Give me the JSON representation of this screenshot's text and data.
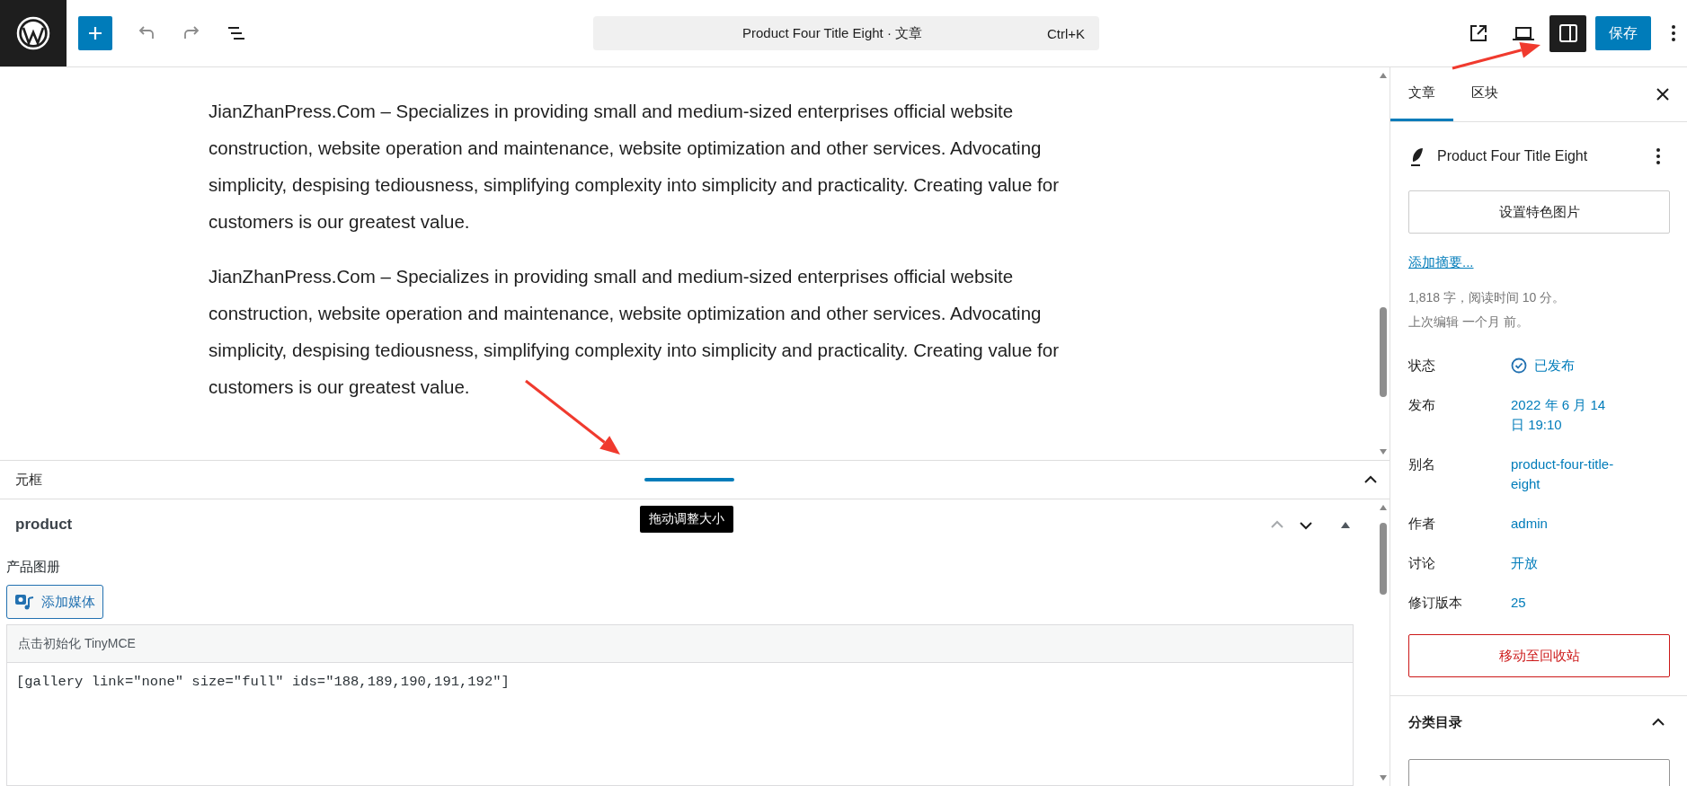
{
  "toolbar": {
    "document_title": "Product Four Title Eight · 文章",
    "shortcut": "Ctrl+K",
    "sidebar_toggle": {
      "on": true
    },
    "save_label": "保存"
  },
  "content": {
    "paragraphs": [
      "JianZhanPress.Com – Specializes in providing small and medium-sized enterprises official website construction, website operation and maintenance, website optimization and other services. Advocating simplicity, despising tediousness, simplifying complexity into simplicity and practicality. Creating value for customers is our greatest value.",
      "JianZhanPress.Com – Specializes in providing small and medium-sized enterprises official website construction, website operation and maintenance, website optimization and other services. Advocating simplicity, despising tediousness, simplifying complexity into simplicity and practicality. Creating value for customers is our greatest value."
    ]
  },
  "meta_boxes": {
    "title": "元框",
    "expanded": true,
    "resize_tooltip": "拖动调整大小",
    "box": {
      "title": "product",
      "field_label": "产品图册",
      "add_media": "添加媒体",
      "tinymce_hint": "点击初始化 TinyMCE",
      "value": "[gallery link=\"none\" size=\"full\" ids=\"188,189,190,191,192\"]"
    }
  },
  "sidebar": {
    "tabs": [
      {
        "label": "文章",
        "selected": true
      },
      {
        "label": "区块",
        "selected": false
      }
    ],
    "post_title": "Product Four Title Eight",
    "featured_image_button": "设置特色图片",
    "excerpt_link": "添加摘要...",
    "stats": [
      "1,818 字，阅读时间 10 分。",
      "上次编辑 一个月 前。"
    ],
    "rows": [
      {
        "label": "状态",
        "value": "已发布",
        "kind": "status"
      },
      {
        "label": "发布",
        "value": "2022 年 6 月 14 日 19:10",
        "kind": "link"
      },
      {
        "label": "别名",
        "value": "product-four-title-eight",
        "kind": "link"
      },
      {
        "label": "作者",
        "value": "admin",
        "kind": "link"
      },
      {
        "label": "讨论",
        "value": "开放",
        "kind": "link"
      },
      {
        "label": "修订版本",
        "value": "25",
        "kind": "link"
      }
    ],
    "trash_button": "移动至回收站",
    "panels": [
      {
        "title": "分类目录",
        "expanded": true
      }
    ]
  }
}
